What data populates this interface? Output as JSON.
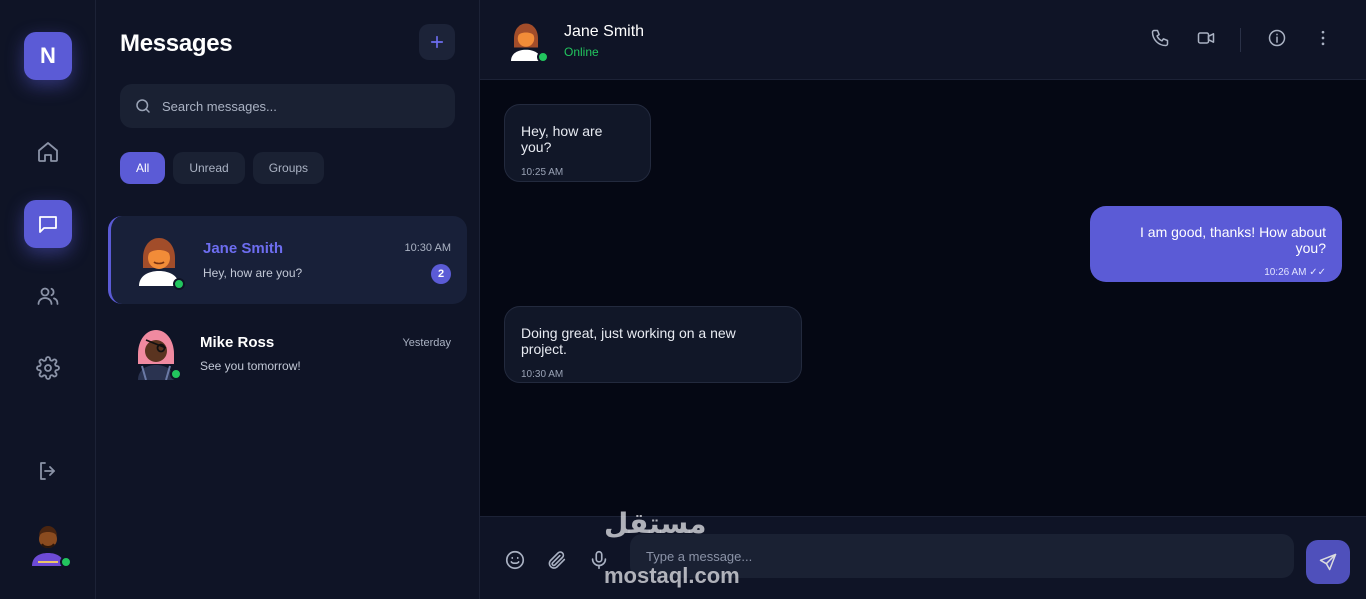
{
  "rail": {
    "logo_letter": "N",
    "nav": [
      {
        "icon": "home-icon"
      },
      {
        "icon": "chat-icon",
        "active": true
      },
      {
        "icon": "users-icon"
      },
      {
        "icon": "gear-icon"
      },
      {
        "icon": "logout-icon"
      }
    ]
  },
  "list": {
    "title": "Messages",
    "search_placeholder": "Search messages...",
    "filters": [
      "All",
      "Unread",
      "Groups"
    ],
    "conversations": [
      {
        "name": "Jane Smith",
        "time": "10:30 AM",
        "preview": "Hey, how are you?",
        "unread": "2",
        "online": true,
        "active": true
      },
      {
        "name": "Mike Ross",
        "time": "Yesterday",
        "preview": "See you tomorrow!",
        "online": true
      }
    ]
  },
  "chat": {
    "contact_name": "Jane Smith",
    "status": "Online",
    "messages": [
      {
        "text": "Hey, how are you?",
        "time": "10:25 AM",
        "direction": "in"
      },
      {
        "text": "I am good, thanks! How about you?",
        "time": "10:26 AM",
        "direction": "out",
        "read_mark": "✓✓"
      },
      {
        "text": "Doing great, just working on a new project.",
        "time": "10:30 AM",
        "direction": "in"
      }
    ],
    "composer_placeholder": "Type a message..."
  },
  "watermark": {
    "arabic": "مستقل",
    "latin": "mostaql.com"
  },
  "colors": {
    "accent": "#5b5bd6",
    "online": "#22c55e",
    "panel": "#0f1426",
    "background": "#050814"
  }
}
